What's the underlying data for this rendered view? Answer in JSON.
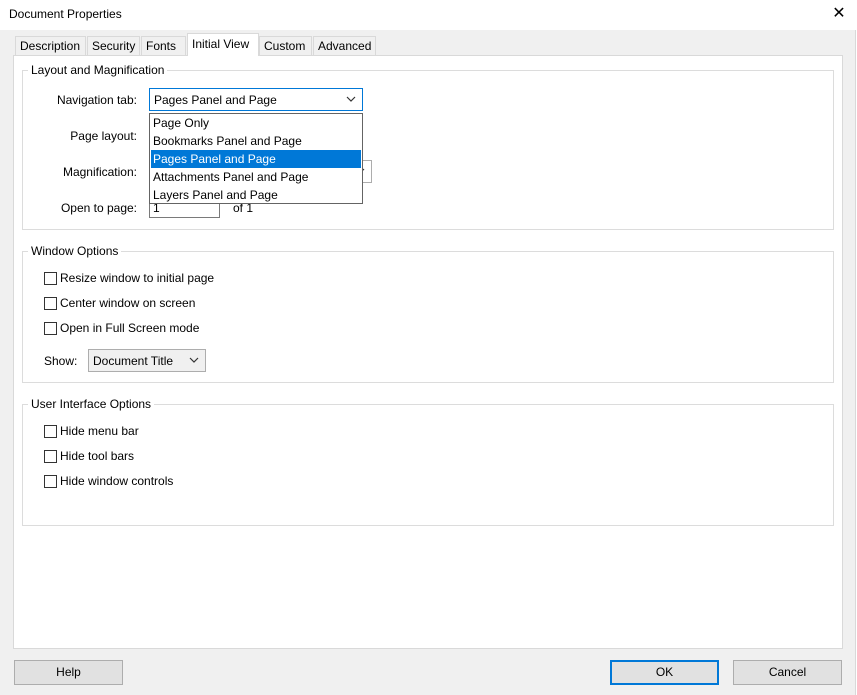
{
  "window": {
    "title": "Document Properties"
  },
  "tabs": [
    {
      "label": "Description"
    },
    {
      "label": "Security"
    },
    {
      "label": "Fonts"
    },
    {
      "label": "Initial View"
    },
    {
      "label": "Custom"
    },
    {
      "label": "Advanced"
    }
  ],
  "layout_group": {
    "title": "Layout and Magnification",
    "navigation_label": "Navigation tab:",
    "navigation_value": "Pages Panel and Page",
    "page_layout_label": "Page layout:",
    "magnification_label": "Magnification:",
    "open_to_page_label": "Open to page:",
    "open_to_page_value": "1",
    "of_pages": "of 1",
    "dropdown_options": [
      "Page Only",
      "Bookmarks Panel and Page",
      "Pages Panel and Page",
      "Attachments Panel and Page",
      "Layers Panel and Page"
    ]
  },
  "window_options": {
    "title": "Window Options",
    "resize": "Resize window to initial page",
    "center": "Center window on screen",
    "fullscreen": "Open in Full Screen mode",
    "show_label": "Show:",
    "show_value": "Document Title"
  },
  "ui_options": {
    "title": "User Interface Options",
    "hide_menu": "Hide menu bar",
    "hide_toolbars": "Hide tool bars",
    "hide_window_controls": "Hide window controls"
  },
  "buttons": {
    "help": "Help",
    "ok": "OK",
    "cancel": "Cancel"
  },
  "colors": {
    "accent": "#0078d7",
    "dialog_bg": "#f0f0f0",
    "button_bg": "#e1e1e1"
  }
}
